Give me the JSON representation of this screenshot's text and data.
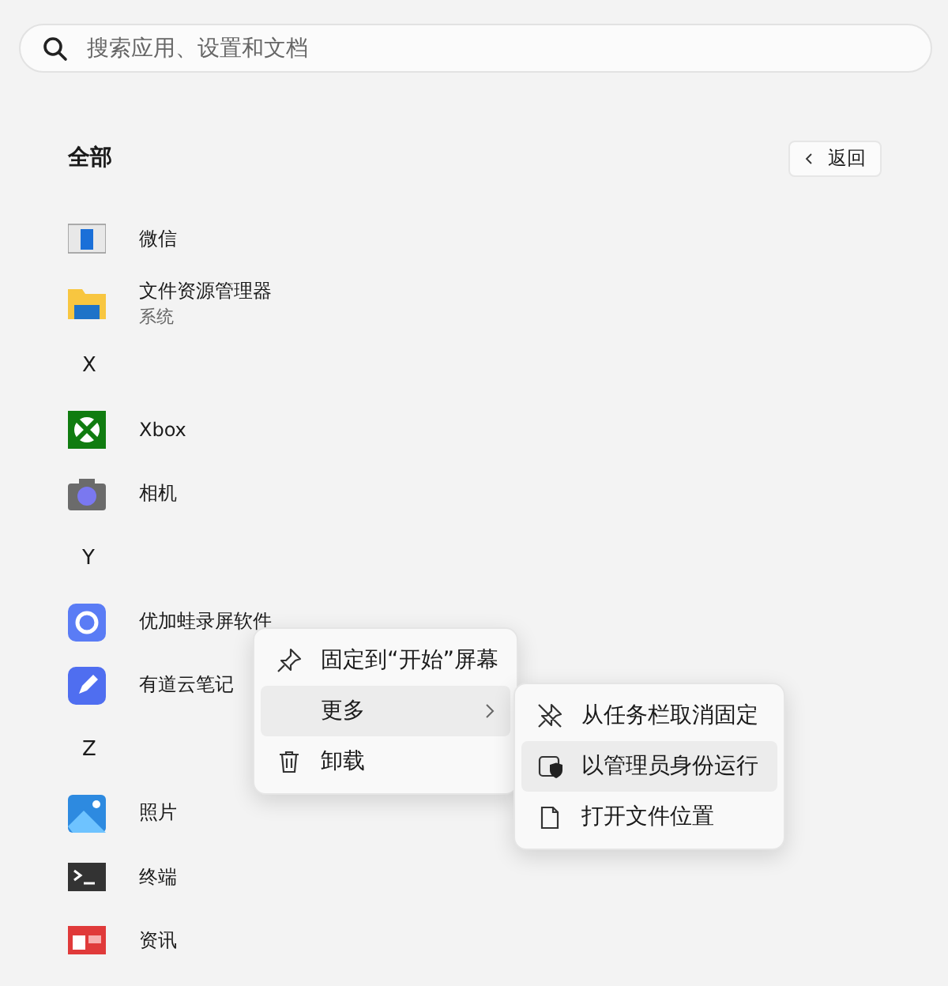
{
  "search": {
    "placeholder": "搜索应用、设置和文档"
  },
  "header": {
    "title": "全部",
    "back_button": "返回"
  },
  "apps": [
    {
      "kind": "app",
      "name": "微信"
    },
    {
      "kind": "app",
      "name": "文件资源管理器",
      "subtitle": "系统"
    },
    {
      "kind": "letter",
      "name": "X"
    },
    {
      "kind": "app",
      "name": "Xbox"
    },
    {
      "kind": "app",
      "name": "相机"
    },
    {
      "kind": "letter",
      "name": "Y"
    },
    {
      "kind": "app",
      "name": "优加蛙录屏软件"
    },
    {
      "kind": "app",
      "name": "有道云笔记"
    },
    {
      "kind": "letter",
      "name": "Z"
    },
    {
      "kind": "app",
      "name": "照片"
    },
    {
      "kind": "app",
      "name": "终端"
    },
    {
      "kind": "app",
      "name": "资讯"
    }
  ],
  "context_menu": {
    "items": [
      {
        "label": "固定到“开始”屏幕",
        "selected": false,
        "submenu": false
      },
      {
        "label": "更多",
        "selected": true,
        "submenu": true
      },
      {
        "label": "卸载",
        "selected": false,
        "submenu": false
      }
    ]
  },
  "submenu": {
    "items": [
      {
        "label": "从任务栏取消固定",
        "selected": false
      },
      {
        "label": "以管理员身份运行",
        "selected": true
      },
      {
        "label": "打开文件位置",
        "selected": false
      }
    ]
  }
}
